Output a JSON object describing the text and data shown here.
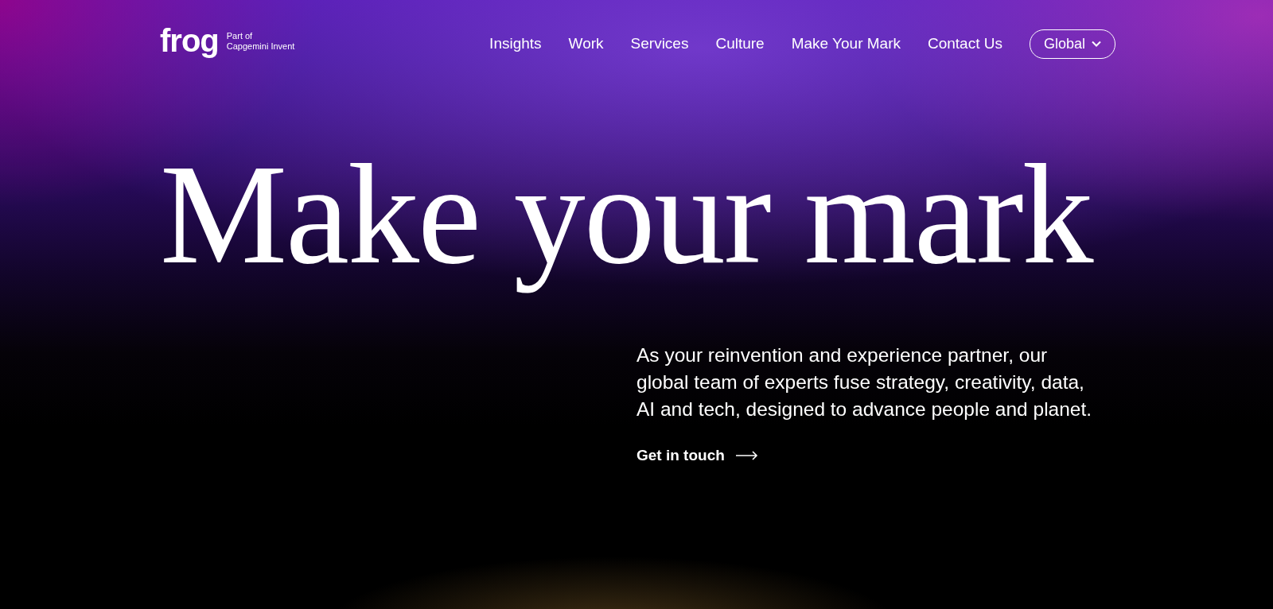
{
  "logo": {
    "wordmark": "frog",
    "tagline": [
      "Part of",
      "Capgemini Invent"
    ]
  },
  "nav": {
    "items": [
      "Insights",
      "Work",
      "Services",
      "Culture",
      "Make Your Mark",
      "Contact Us"
    ],
    "region": "Global"
  },
  "hero": {
    "headline": "Make your mark",
    "intro": [
      "As your reinvention and experience partner, our",
      "global team of experts fuse strategy, creativity, data,",
      "AI and tech, designed to advance people and planet."
    ],
    "cta": "Get in touch"
  }
}
